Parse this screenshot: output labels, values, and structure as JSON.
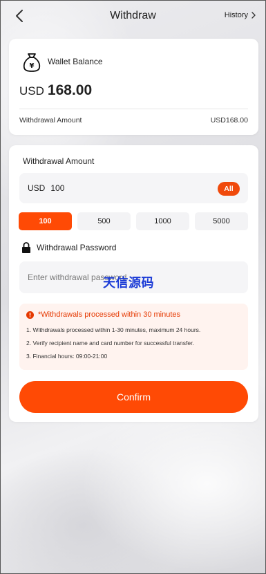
{
  "header": {
    "title": "Withdraw",
    "history_label": "History"
  },
  "balance_card": {
    "label": "Wallet Balance",
    "currency": "USD",
    "amount": "168.00",
    "withdrawal_amount_label": "Withdrawal Amount",
    "withdrawal_amount_value": "USD168.00"
  },
  "withdraw_form": {
    "amount_label": "Withdrawal Amount",
    "currency": "USD",
    "amount_value": "100",
    "all_label": "All",
    "presets": [
      "100",
      "500",
      "1000",
      "5000"
    ],
    "selected_preset": "100",
    "password_label": "Withdrawal Password",
    "password_placeholder": "Enter withdrawal password"
  },
  "watermark": "天信源码",
  "notice": {
    "title": "*Withdrawals processed within 30 minutes",
    "lines": [
      "1. Withdrawals processed within 1-30 minutes, maximum 24 hours.",
      "2. Verify recipient name and card number for successful transfer.",
      "3. Financial hours: 09:00-21:00"
    ]
  },
  "confirm_label": "Confirm",
  "colors": {
    "accent": "#ff4a05",
    "notice_text": "#e53800",
    "notice_bg": "#fff3ef"
  },
  "icons": {
    "back": "chevron-left-icon",
    "history": "chevron-right-icon",
    "wallet": "money-bag-icon",
    "lock": "lock-icon",
    "info": "info-icon"
  }
}
